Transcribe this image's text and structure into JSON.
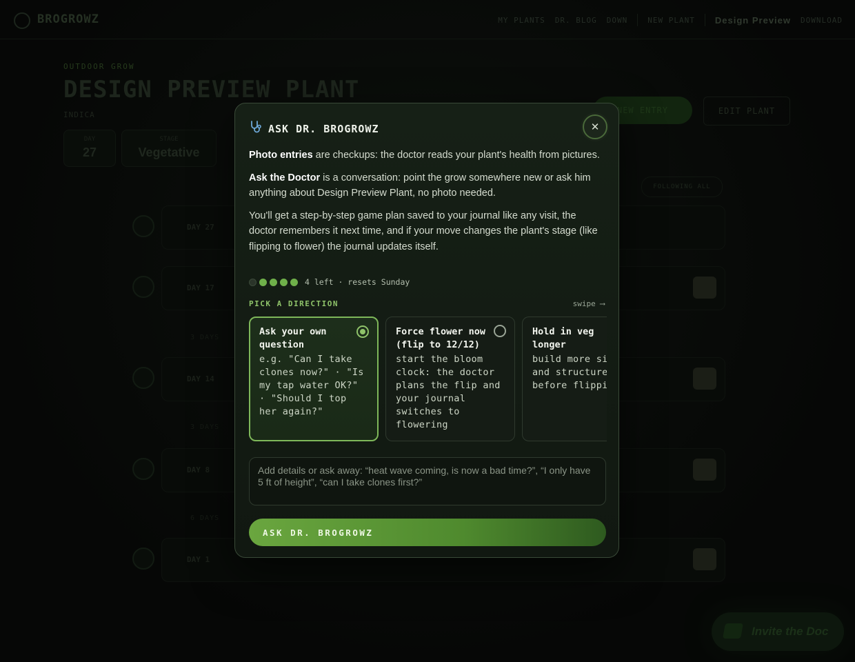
{
  "background": {
    "brand": "BROGROWZ",
    "nav": [
      "MY PLANTS",
      "DR. BLOG",
      "DOWN",
      "NEW PLANT"
    ],
    "nav_strong": "Design Preview",
    "nav_last": "DOWNLOAD",
    "eyebrow": "OUTDOOR GROW",
    "plant_title": "DESIGN PREVIEW PLANT",
    "strain": "INDICA",
    "stats": [
      {
        "label": "DAY",
        "value": "27"
      },
      {
        "label": "STAGE",
        "value": "Vegetative"
      }
    ],
    "new_entry": "NEW ENTRY",
    "edit_plant": "EDIT PLANT",
    "filter": "FOLLOWING ALL",
    "timeline": [
      {
        "day": "DAY 27"
      },
      {
        "day": "DAY 17"
      },
      {
        "day": "DAY 14"
      },
      {
        "day": "DAY 8"
      },
      {
        "day": "DAY 1"
      }
    ],
    "timeline_gaps": [
      "3 DAYS",
      "3 DAYS",
      "6 DAYS"
    ],
    "doctor_pill": "Invite the Doc"
  },
  "modal": {
    "title": "ASK DR. BROGROWZ",
    "close": "✕",
    "p1_bold": "Photo entries",
    "p1_rest": " are checkups: the doctor reads your plant's health from pictures.",
    "p2_bold": "Ask the Doctor",
    "p2_rest": " is a conversation: point the grow somewhere new or ask him anything about Design Preview Plant, no photo needed.",
    "p3": "You'll get a step-by-step game plan saved to your journal like any visit, the doctor remembers it next time, and if your move changes the plant's stage (like flipping to flower) the journal updates itself.",
    "quota": {
      "used": 1,
      "total": 5,
      "text": "4 left · resets Sunday"
    },
    "pick_label": "PICK A DIRECTION",
    "swipe": "swipe ⟶",
    "options": [
      {
        "title": "Ask your own question",
        "desc": "e.g. \"Can I take clones now?\" · \"Is my tap water OK?\" · \"Should I top her again?\"",
        "selected": true
      },
      {
        "title": "Force flower now (flip to 12/12)",
        "desc": "start the bloom clock: the doctor plans the flip and your journal switches to flowering",
        "selected": false
      },
      {
        "title": "Hold in veg longer",
        "desc": "build more size and structure before flipping",
        "selected": false
      }
    ],
    "textarea_placeholder": "Add details or ask away: “heat wave coming, is now a bad time?”, “I only have 5 ft of height”, “can I take clones first?”",
    "ask_button": "ASK DR. BROGROWZ"
  },
  "colors": {
    "accent": "#8fc36a",
    "button_start": "#6aa63f",
    "modal_border": "#3a4a38"
  }
}
